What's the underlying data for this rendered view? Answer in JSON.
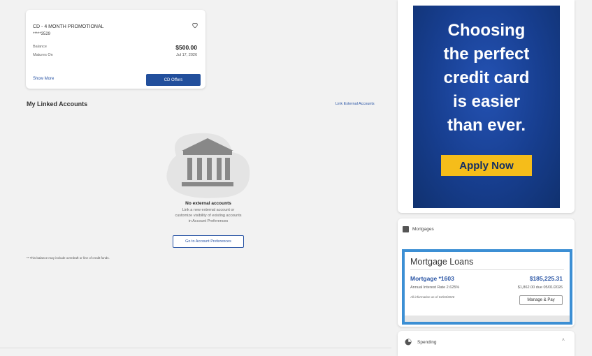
{
  "cd": {
    "title": "CD - 4 MONTH PROMOTIONAL",
    "masked_number": "*****3529",
    "balance_label": "Balance",
    "balance_value": "$500.00",
    "matures_label": "Matures On",
    "matures_value": "Jul 17, 2026",
    "show_more": "Show More",
    "offers_button": "CD Offers",
    "icon": "heart-icon"
  },
  "linked": {
    "title": "My Linked Accounts",
    "link_external": "Link External Accounts",
    "empty_title": "No external accounts",
    "empty_desc_lines": [
      "Link a new external account or",
      "customize visibility of existing accounts",
      "in Account Preferences"
    ],
    "preferences_button": "Go to Account Preferences",
    "footnote": "** This balance may include overdraft or line of credit funds."
  },
  "ad": {
    "lines": [
      "Choosing",
      "the perfect",
      "credit card",
      "is easier",
      "than ever."
    ],
    "apply_button": "Apply Now",
    "colors": {
      "background": "#1a4294",
      "button": "#f5bd1a"
    }
  },
  "mortgages": {
    "section_label": "Mortgages",
    "card_title": "Mortgage Loans",
    "loan_name": "Mortgage *1603",
    "loan_amount": "$185,225.31",
    "rate_text": "Annual Interest Rate  2.625%",
    "due_text": "$1,862.00 due  05/01/2026",
    "as_of_text": "All information as of  04/03/2026",
    "manage_button": "Manage & Pay",
    "highlight_color": "#3c8fd4"
  },
  "spending": {
    "label": "Spending",
    "caret": "˄"
  }
}
